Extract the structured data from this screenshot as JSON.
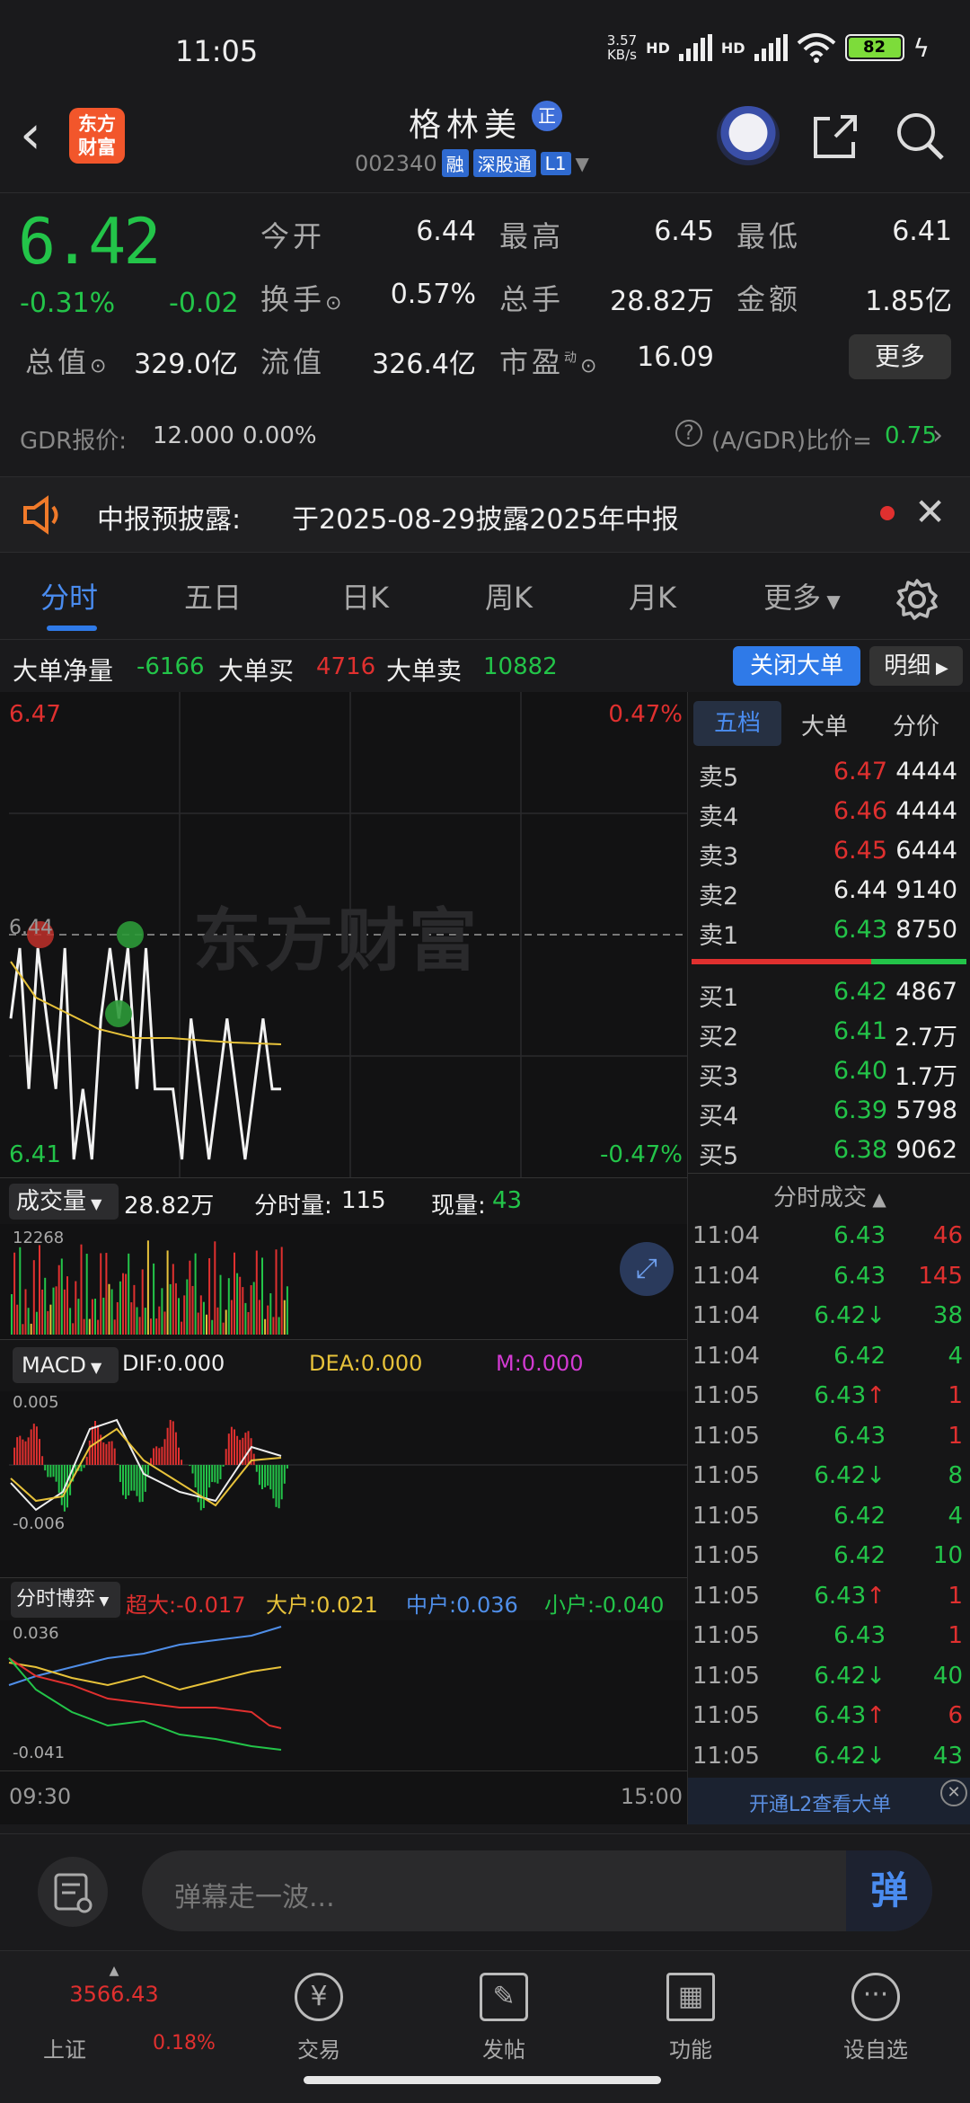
{
  "status_bar": {
    "time": "11:05",
    "net_speed_top": "3.57",
    "net_speed_bottom": "KB/s",
    "hd1": "HD",
    "hd2": "HD",
    "battery": "82"
  },
  "header": {
    "logo_line1": "东方",
    "logo_line2": "财富",
    "stock_name": "格林美",
    "zheng_badge": "正",
    "code": "002340",
    "tag_rong": "融",
    "tag_sgt": "深股通",
    "tag_l1": "L1"
  },
  "quote": {
    "price": "6.42",
    "pct_change": "-0.31%",
    "abs_change": "-0.02",
    "open_label": "今开",
    "open": "6.44",
    "high_label": "最高",
    "high": "6.45",
    "low_label": "最低",
    "low": "6.41",
    "turnover_label": "换手",
    "turnover": "0.57%",
    "volume_label": "总手",
    "volume": "28.82万",
    "amount_label": "金额",
    "amount": "1.85亿",
    "mktcap_label": "总值",
    "mktcap": "329.0亿",
    "float_label": "流值",
    "float_cap": "326.4亿",
    "pe_label": "市盈",
    "pe_sup": "动",
    "pe": "16.09",
    "more_button": "更多",
    "gdr_label": "GDR报价:",
    "gdr_price": "12.000",
    "gdr_pct": "0.00%",
    "ratio_label": "(A/GDR)比价=",
    "ratio_value": "0.75"
  },
  "notice": {
    "label": "中报预披露:",
    "text": "于2025-08-29披露2025年中报"
  },
  "tabs": [
    "分时",
    "五日",
    "日K",
    "周K",
    "月K",
    "更多"
  ],
  "big_order": {
    "net_label": "大单净量",
    "net": "-6166",
    "buy_label": "大单买",
    "buy": "4716",
    "sell_label": "大单卖",
    "sell": "10882",
    "close_button": "关闭大单",
    "detail_button": "明细"
  },
  "intraday": {
    "top_left": "6.47",
    "top_right": "0.47%",
    "bottom_left": "6.41",
    "bottom_right": "-0.47%",
    "ref_label": "6.44",
    "watermark": "东方财富",
    "vol_selector": "成交量",
    "vol_total": "28.82万",
    "min_vol_label": "分时量:",
    "min_vol": "115",
    "cur_vol_label": "现量:",
    "cur_vol": "43",
    "vol_max": "12268",
    "macd_selector": "MACD",
    "dif": "DIF:0.000",
    "dea": "DEA:0.000",
    "m": "M:0.000",
    "macd_top": "0.005",
    "macd_bottom": "-0.006",
    "fund_selector": "分时博弈",
    "super": "超大:-0.017",
    "large": "大户:0.021",
    "medium": "中户:0.036",
    "small": "小户:-0.040",
    "fund_top": "0.036",
    "fund_bottom": "-0.041",
    "time_start": "09:30",
    "time_end": "15:00"
  },
  "book": {
    "tabs": [
      "五档",
      "大单",
      "分价"
    ],
    "asks": [
      {
        "label": "卖5",
        "price": "6.47",
        "vol": "4444"
      },
      {
        "label": "卖4",
        "price": "6.46",
        "vol": "4444"
      },
      {
        "label": "卖3",
        "price": "6.45",
        "vol": "6444"
      },
      {
        "label": "卖2",
        "price": "6.44",
        "vol": "9140"
      },
      {
        "label": "卖1",
        "price": "6.43",
        "vol": "8750"
      }
    ],
    "bids": [
      {
        "label": "买1",
        "price": "6.42",
        "vol": "4867"
      },
      {
        "label": "买2",
        "price": "6.41",
        "vol": "2.7万"
      },
      {
        "label": "买3",
        "price": "6.40",
        "vol": "1.7万"
      },
      {
        "label": "买4",
        "price": "6.39",
        "vol": "5798"
      },
      {
        "label": "买5",
        "price": "6.38",
        "vol": "9062"
      }
    ],
    "ticks_title": "分时成交",
    "ticks": [
      {
        "t": "11:04",
        "p": "6.43",
        "a": "",
        "v": "46",
        "c": "red"
      },
      {
        "t": "11:04",
        "p": "6.43",
        "a": "",
        "v": "145",
        "c": "red"
      },
      {
        "t": "11:04",
        "p": "6.42",
        "a": "↓",
        "v": "38",
        "c": "green"
      },
      {
        "t": "11:04",
        "p": "6.42",
        "a": "",
        "v": "4",
        "c": "green"
      },
      {
        "t": "11:05",
        "p": "6.43",
        "a": "↑",
        "v": "1",
        "c": "red"
      },
      {
        "t": "11:05",
        "p": "6.43",
        "a": "",
        "v": "1",
        "c": "red"
      },
      {
        "t": "11:05",
        "p": "6.42",
        "a": "↓",
        "v": "8",
        "c": "green"
      },
      {
        "t": "11:05",
        "p": "6.42",
        "a": "",
        "v": "4",
        "c": "green"
      },
      {
        "t": "11:05",
        "p": "6.42",
        "a": "",
        "v": "10",
        "c": "green"
      },
      {
        "t": "11:05",
        "p": "6.43",
        "a": "↑",
        "v": "1",
        "c": "red"
      },
      {
        "t": "11:05",
        "p": "6.43",
        "a": "",
        "v": "1",
        "c": "red"
      },
      {
        "t": "11:05",
        "p": "6.42",
        "a": "↓",
        "v": "40",
        "c": "green"
      },
      {
        "t": "11:05",
        "p": "6.43",
        "a": "↑",
        "v": "6",
        "c": "red"
      },
      {
        "t": "11:05",
        "p": "6.42",
        "a": "↓",
        "v": "43",
        "c": "green"
      }
    ],
    "promo": "开通L2查看大单"
  },
  "input": {
    "placeholder": "弹幕走一波...",
    "send_glyph": "弹"
  },
  "bottom_nav": {
    "index_value": "3566.43",
    "index_name": "上证",
    "index_pct": "0.18%",
    "trade": "交易",
    "post": "发帖",
    "func": "功能",
    "custom": "设自选"
  },
  "chart_data": {
    "type": "line",
    "title": "",
    "x": [
      "09:30",
      "15:00"
    ],
    "ylim": [
      6.41,
      6.47
    ],
    "ref_price": 6.44,
    "series": [
      {
        "name": "",
        "values": [
          6.43,
          6.44,
          6.42,
          6.44,
          6.43,
          6.42,
          6.44,
          6.41,
          6.42,
          6.41,
          6.43,
          6.44,
          6.43,
          6.44,
          6.42,
          6.44,
          6.42,
          6.42,
          6.42,
          6.41,
          6.43,
          6.42,
          6.41,
          6.42,
          6.43,
          6.42,
          6.41,
          6.42,
          6.43,
          6.42,
          6.42
        ]
      }
    ]
  },
  "colors": {
    "up": "#e0302f",
    "down": "#23c449",
    "accent": "#2f7ae8"
  }
}
